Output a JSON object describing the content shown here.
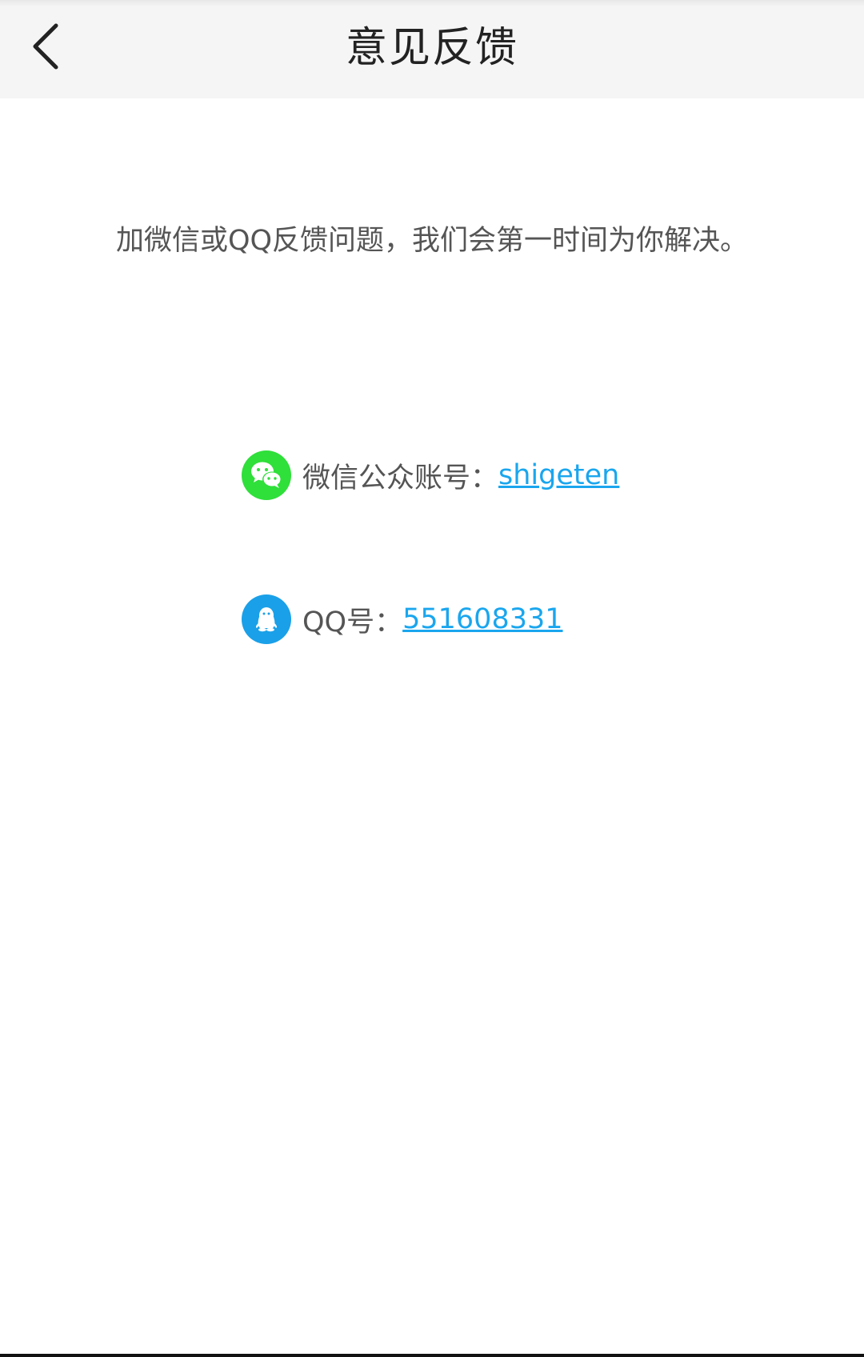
{
  "header": {
    "title": "意见反馈",
    "back_icon": "chevron-left-icon"
  },
  "main": {
    "intro": "加微信或QQ反馈问题，我们会第一时间为你解决。",
    "wechat": {
      "icon": "wechat-icon",
      "label": "微信公众账号：",
      "value": "shigeten",
      "icon_color": "#2fdf3a"
    },
    "qq": {
      "icon": "qq-icon",
      "label": "QQ号：",
      "value": "551608331",
      "icon_color": "#1aa0e8"
    }
  },
  "colors": {
    "link": "#1aa6ee",
    "text": "#555555",
    "title": "#222222",
    "header_bg": "#f5f5f5"
  }
}
